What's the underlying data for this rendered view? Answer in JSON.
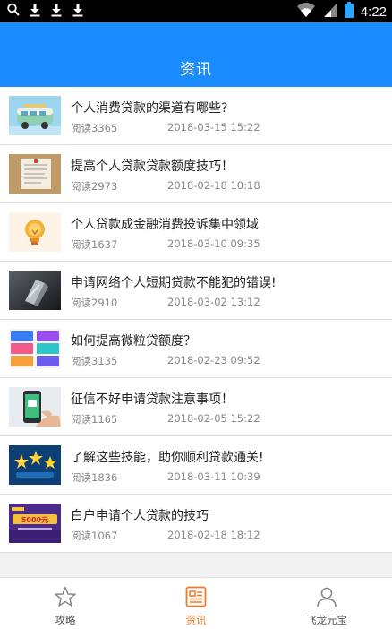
{
  "status_bar": {
    "time": "4:22",
    "icons": [
      "search-icon",
      "download-icon",
      "download-icon",
      "download-icon",
      "wifi-icon",
      "signal-icon",
      "battery-icon"
    ]
  },
  "header": {
    "title": "资讯"
  },
  "articles": [
    {
      "title": "个人消费贷款的渠道有哪些?",
      "reads": "阅读3365",
      "date": "2018-03-15 15:22",
      "thumb": "van"
    },
    {
      "title": "提高个人贷款贷款额度技巧！",
      "reads": "阅读2973",
      "date": "2018-02-18 10:18",
      "thumb": "notice-board"
    },
    {
      "title": "个人贷款成金融消费投诉集中领域",
      "reads": "阅读1637",
      "date": "2018-03-10 09:35",
      "thumb": "lightbulb"
    },
    {
      "title": "申请网络个人短期贷款不能犯的错误!",
      "reads": "阅读2910",
      "date": "2018-03-02 13:12",
      "thumb": "logo-3d"
    },
    {
      "title": "如何提高微粒贷额度？",
      "reads": "阅读3135",
      "date": "2018-02-23 09:52",
      "thumb": "color-cards"
    },
    {
      "title": "征信不好申请贷款注意事项！",
      "reads": "阅读1165",
      "date": "2018-02-05 15:22",
      "thumb": "phone-hand"
    },
    {
      "title": "了解这些技能，助你顺利贷款通关!",
      "reads": "阅读1836",
      "date": "2018-03-11 10:39",
      "thumb": "stars"
    },
    {
      "title": "白户申请个人贷款的技巧",
      "reads": "阅读1067",
      "date": "2018-02-18 18:12",
      "thumb": "banner-5000",
      "thumb_text": "5000元"
    }
  ],
  "tabs": [
    {
      "label": "攻略",
      "icon": "star-icon",
      "active": false
    },
    {
      "label": "资讯",
      "icon": "news-icon",
      "active": true
    },
    {
      "label": "飞龙元宝",
      "icon": "user-icon",
      "active": false
    }
  ],
  "colors": {
    "header": "#1a8cff",
    "tab_active": "#f07a2c",
    "tab_inactive": "#888888"
  }
}
